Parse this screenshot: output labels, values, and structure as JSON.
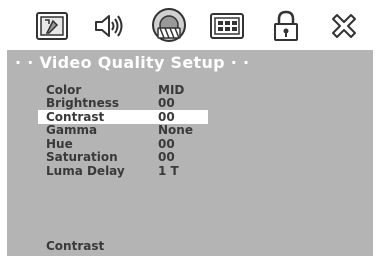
{
  "icons": [
    {
      "name": "general-setup-icon"
    },
    {
      "name": "audio-setup-icon"
    },
    {
      "name": "video-setup-icon"
    },
    {
      "name": "preferences-icon"
    },
    {
      "name": "password-lock-icon"
    },
    {
      "name": "exit-icon"
    }
  ],
  "section": {
    "title": "· · Video Quality Setup · ·"
  },
  "menu": {
    "items": [
      {
        "label": "Color",
        "value": "MID"
      },
      {
        "label": "Brightness",
        "value": "00"
      },
      {
        "label": "Contrast",
        "value": "00"
      },
      {
        "label": "Gamma",
        "value": "None"
      },
      {
        "label": "Hue",
        "value": "00"
      },
      {
        "label": "Saturation",
        "value": "00"
      },
      {
        "label": "Luma Delay",
        "value": "1 T"
      }
    ],
    "selected": "Contrast"
  },
  "status": {
    "text": "Contrast"
  },
  "colors": {
    "panel": "#b4b4b4",
    "text": "#3a3a3a",
    "highlight": "#ffffff"
  }
}
